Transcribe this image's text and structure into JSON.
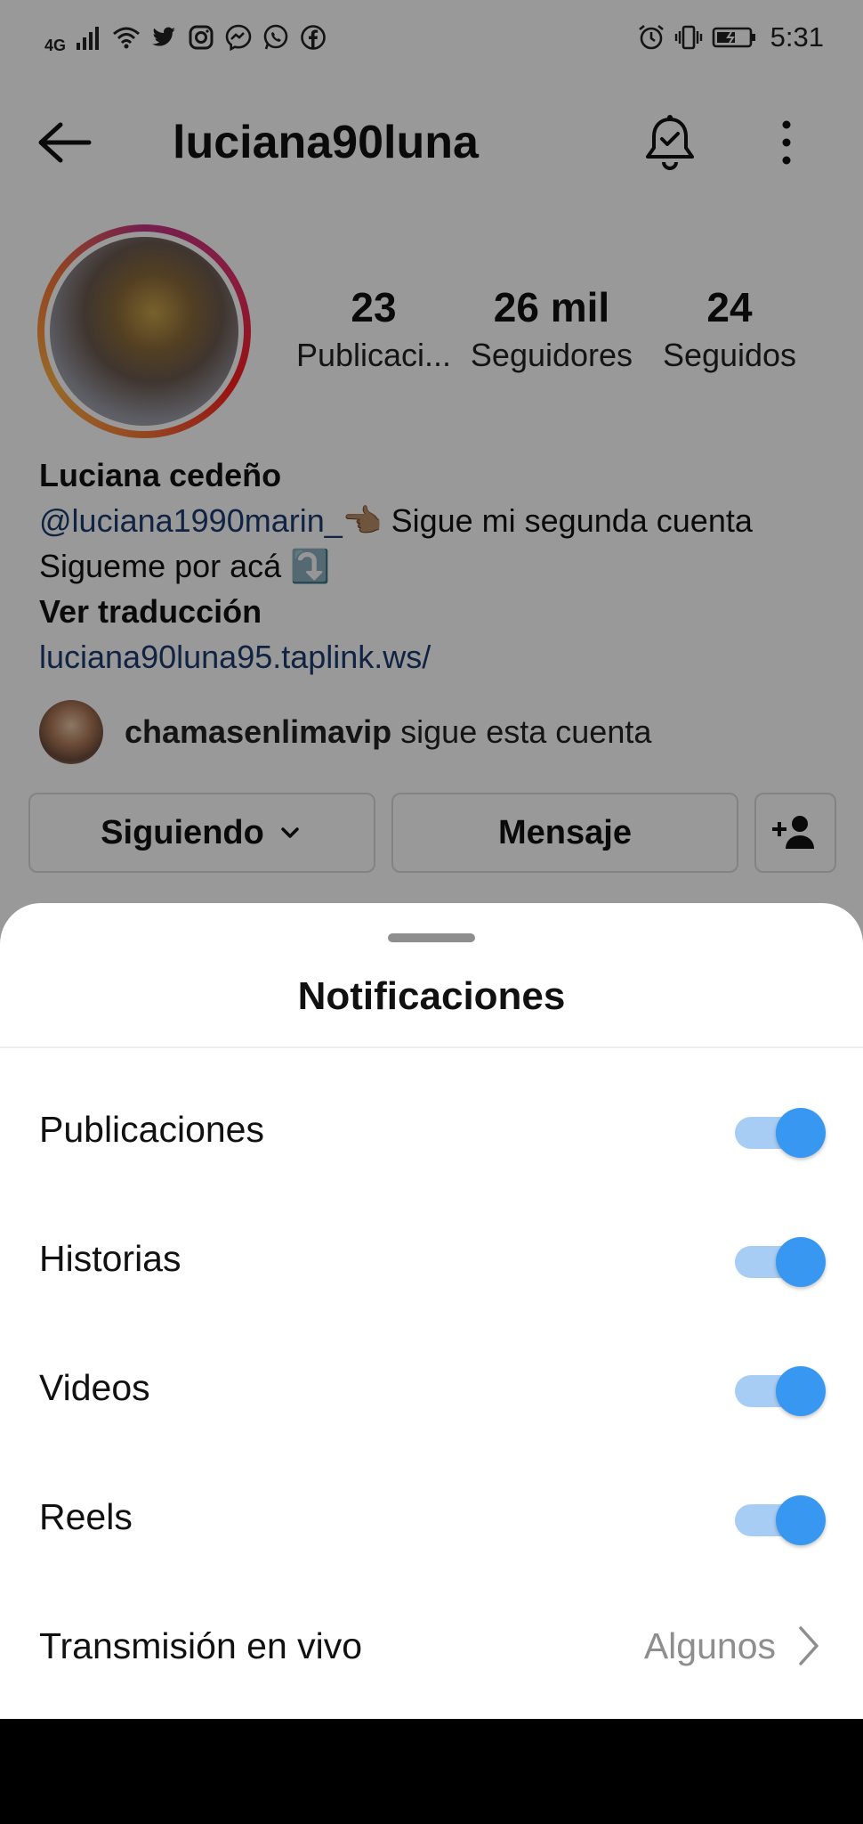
{
  "status_bar": {
    "network": "4G",
    "time": "5:31",
    "icons_left": [
      "signal-icon",
      "wifi-icon",
      "twitter-icon",
      "instagram-icon",
      "messenger-icon",
      "whatsapp-icon",
      "facebook-icon"
    ],
    "icons_right": [
      "alarm-icon",
      "vibrate-icon",
      "battery-icon"
    ]
  },
  "header": {
    "username": "luciana90luna"
  },
  "profile": {
    "stats": [
      {
        "value": "23",
        "label": "Publicaci..."
      },
      {
        "value": "26 mil",
        "label": "Seguidores"
      },
      {
        "value": "24",
        "label": "Seguidos"
      }
    ],
    "name": "Luciana cedeño",
    "bio_mention": "@luciana1990marin_",
    "bio_line1_rest": "👈🏽 Sigue mi segunda cuenta",
    "bio_line2": "Sigueme por acá ⤵️",
    "see_translation": "Ver traducción",
    "website": "luciana90luna95.taplink.ws/",
    "followed_by_user": "chamasenlimavip",
    "followed_by_text": " sigue esta cuenta"
  },
  "actions": {
    "following_label": "Siguiendo",
    "message_label": "Mensaje"
  },
  "sheet": {
    "title": "Notificaciones",
    "rows": [
      {
        "label": "Publicaciones",
        "enabled": true
      },
      {
        "label": "Historias",
        "enabled": true
      },
      {
        "label": "Videos",
        "enabled": true
      },
      {
        "label": "Reels",
        "enabled": true
      }
    ],
    "live": {
      "label": "Transmisión en vivo",
      "value": "Algunos"
    }
  },
  "colors": {
    "accent": "#3897f0",
    "toggle_track": "#a8cdf5",
    "link": "#1b3b6f"
  }
}
